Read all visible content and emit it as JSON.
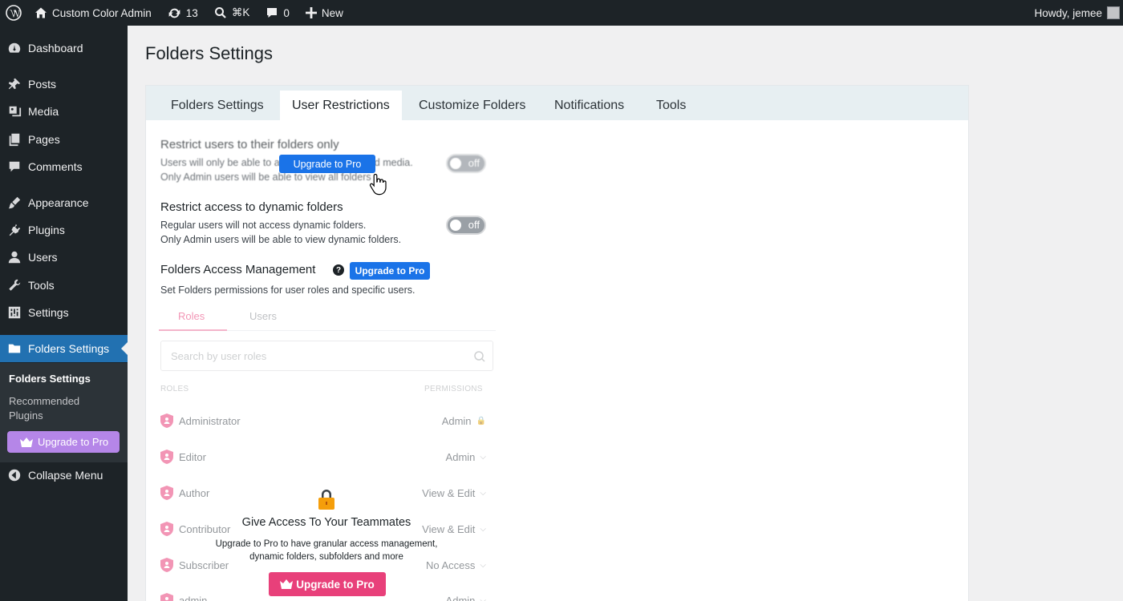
{
  "adminbar": {
    "site_name": "Custom Color Admin",
    "updates_count": "13",
    "search_shortcut": "⌘K",
    "comments_count": "0",
    "new_label": "New",
    "greeting": "Howdy, jemee"
  },
  "sidebar": {
    "items": [
      {
        "label": "Dashboard",
        "icon": "dashboard-icon"
      },
      {
        "label": "Posts",
        "icon": "pin-icon"
      },
      {
        "label": "Media",
        "icon": "media-icon"
      },
      {
        "label": "Pages",
        "icon": "pages-icon"
      },
      {
        "label": "Comments",
        "icon": "comment-icon"
      },
      {
        "label": "Appearance",
        "icon": "brush-icon"
      },
      {
        "label": "Plugins",
        "icon": "plug-icon"
      },
      {
        "label": "Users",
        "icon": "user-icon"
      },
      {
        "label": "Tools",
        "icon": "wrench-icon"
      },
      {
        "label": "Settings",
        "icon": "settings-icon"
      },
      {
        "label": "Folders Settings",
        "icon": "folder-icon"
      }
    ],
    "submenu": {
      "folders_settings": "Folders Settings",
      "recommended_line1": "Recommended",
      "recommended_line2": "Plugins",
      "upgrade": "Upgrade to Pro"
    },
    "collapse": "Collapse Menu"
  },
  "page": {
    "title": "Folders Settings",
    "tabs": [
      "Folders Settings",
      "User Restrictions",
      "Customize Folders",
      "Notifications",
      "Tools"
    ],
    "active_tab": "User Restrictions"
  },
  "settings": {
    "restrict_users": {
      "title": "Restrict users to their folders only",
      "desc_line1": "Users will only be able to access their folders and media.",
      "desc_line2": "Only Admin users will be able to view all folders",
      "toggle": "off",
      "upgrade": "Upgrade to Pro"
    },
    "restrict_dynamic": {
      "title": "Restrict access to dynamic folders",
      "desc_line1": "Regular users will not access dynamic folders.",
      "desc_line2": "Only Admin users will be able to view dynamic folders.",
      "toggle": "off"
    },
    "access_mgmt": {
      "title": "Folders Access Management",
      "help": "?",
      "upgrade": "Upgrade to Pro",
      "desc": "Set Folders permissions for user roles and specific users."
    }
  },
  "access": {
    "tabs": [
      "Roles",
      "Users"
    ],
    "search_placeholder": "Search by user roles",
    "col_roles": "ROLES",
    "col_permissions": "PERMISSIONS",
    "rows": [
      {
        "role": "Administrator",
        "permission": "Admin"
      },
      {
        "role": "Editor",
        "permission": "Admin"
      },
      {
        "role": "Author",
        "permission": "View & Edit"
      },
      {
        "role": "Contributor",
        "permission": "View & Edit"
      },
      {
        "role": "Subscriber",
        "permission": "No Access"
      },
      {
        "role": "admin",
        "permission": "Admin"
      }
    ]
  },
  "overlay": {
    "title": "Give Access To Your Teammates",
    "desc_line1": "Upgrade to Pro to have granular access management,",
    "desc_line2": "dynamic folders, subfolders and more",
    "button": "Upgrade to Pro"
  },
  "colors": {
    "admin_dark": "#1d2327",
    "current_blue": "#2271b1",
    "upgrade_blue": "#1a73e8",
    "pink": "#e8407a",
    "purple": "#b586e8"
  }
}
